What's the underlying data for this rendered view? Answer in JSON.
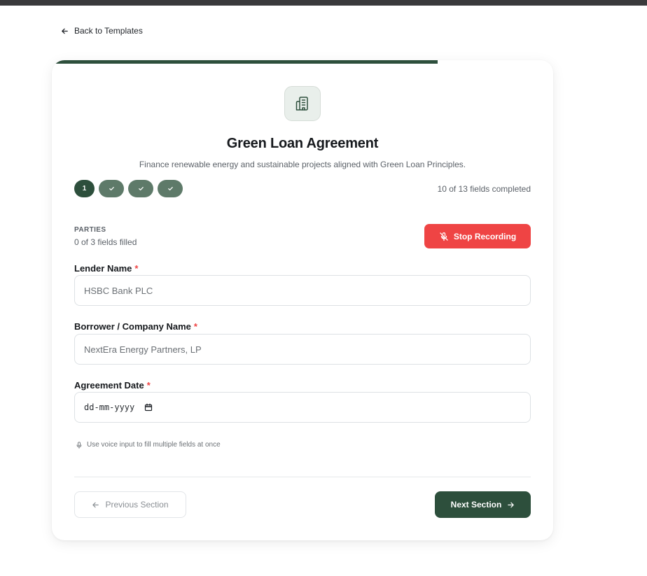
{
  "nav": {
    "back_label": "Back to Templates"
  },
  "progress": {
    "fraction": 0.769
  },
  "form": {
    "title": "Green Loan Agreement",
    "description": "Finance renewable energy and sustainable projects aligned with Green Loan Principles.",
    "steps": [
      {
        "label": "1",
        "state": "current"
      },
      {
        "label": "",
        "state": "done"
      },
      {
        "label": "",
        "state": "done"
      },
      {
        "label": "",
        "state": "done"
      }
    ],
    "fields_completed": "10 of 13 fields completed"
  },
  "section": {
    "name": "PARTIES",
    "filled": "0 of 3 fields filled",
    "record_button": "Stop Recording"
  },
  "fields": {
    "lender": {
      "label": "Lender Name",
      "required": "*",
      "placeholder": "HSBC Bank PLC"
    },
    "borrower": {
      "label": "Borrower / Company Name",
      "required": "*",
      "placeholder": "NextEra Energy Partners, LP"
    },
    "date": {
      "label": "Agreement Date",
      "required": "*",
      "placeholder": "dd-mm-yyyy"
    }
  },
  "voice_hint": "Use voice input to fill multiple fields at once",
  "footer": {
    "prev_label": "Previous Section",
    "next_label": "Next Section"
  },
  "colors": {
    "accent": "#2d4f3c",
    "step_done": "#5e7a69",
    "danger": "#ef4444"
  },
  "icons": {
    "back": "arrow-left-icon",
    "hero": "building-icon",
    "step_done": "check-icon",
    "record": "mic-off-icon",
    "calendar": "calendar-icon",
    "voice": "mic-icon",
    "prev": "arrow-left-icon",
    "next": "arrow-right-icon"
  }
}
